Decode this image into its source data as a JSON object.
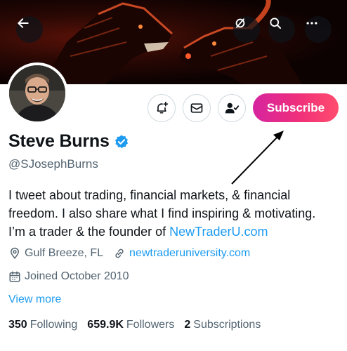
{
  "header": {
    "back_icon": "arrow-left-icon",
    "buttons": [
      "no-notifications-icon",
      "search-icon",
      "more-icon"
    ]
  },
  "profile": {
    "name": "Steve Burns",
    "handle": "@SJosephBurns",
    "verified": true,
    "subscribe_label": "Subscribe",
    "accent": "#1d9bf0",
    "subscribe_colors": [
      "#d6249f",
      "#ff4d6d"
    ]
  },
  "bio": {
    "line1": "I tweet about trading, financial markets, & financial",
    "line2": "freedom. I also share what I find inspiring & motivating.",
    "line3_prefix": "I’m a trader & the founder of ",
    "line3_link": "NewTraderU.com"
  },
  "meta": {
    "location": "Gulf Breeze, FL",
    "website": "newtraderuniversity.com",
    "joined": "Joined October 2010",
    "view_more": "View more"
  },
  "stats": {
    "following_count": "350",
    "following_label": "Following",
    "followers_count": "659.9K",
    "followers_label": "Followers",
    "subscriptions_count": "2",
    "subscriptions_label": "Subscriptions"
  }
}
